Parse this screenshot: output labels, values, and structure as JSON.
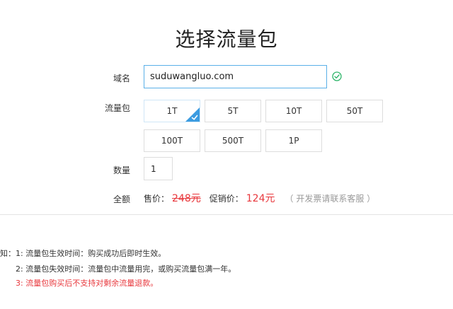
{
  "page": {
    "title": "选择流量包"
  },
  "form": {
    "domain_label": "域名",
    "domain_value": "suduwangluo.com",
    "package_label": "流量包",
    "packages": [
      "1T",
      "5T",
      "10T",
      "50T",
      "100T",
      "500T",
      "1P"
    ],
    "selected_package": "1T",
    "quantity_label": "数量",
    "quantity_value": "1",
    "amount_label": "全额"
  },
  "price": {
    "sale_label": "售价：",
    "sale_value": "248元",
    "promo_label": "促销价：",
    "promo_value": "124元",
    "invoice_note": "（ 开发票请联系客服 ）"
  },
  "notice": {
    "line1": "知：1: 流量包生效时间：购买成功后即时生效。",
    "line2": "2: 流量包失效时间：流量包中流量用完，或购买流量包满一年。",
    "line3": "3: 流量包购买后不支持对剩余流量退款。"
  },
  "colors": {
    "accent": "#3b9be0",
    "price_red": "#e8383d",
    "valid_green": "#2fb56a"
  },
  "icons": {
    "valid": "check-circle-icon",
    "selected": "check-corner-icon"
  }
}
